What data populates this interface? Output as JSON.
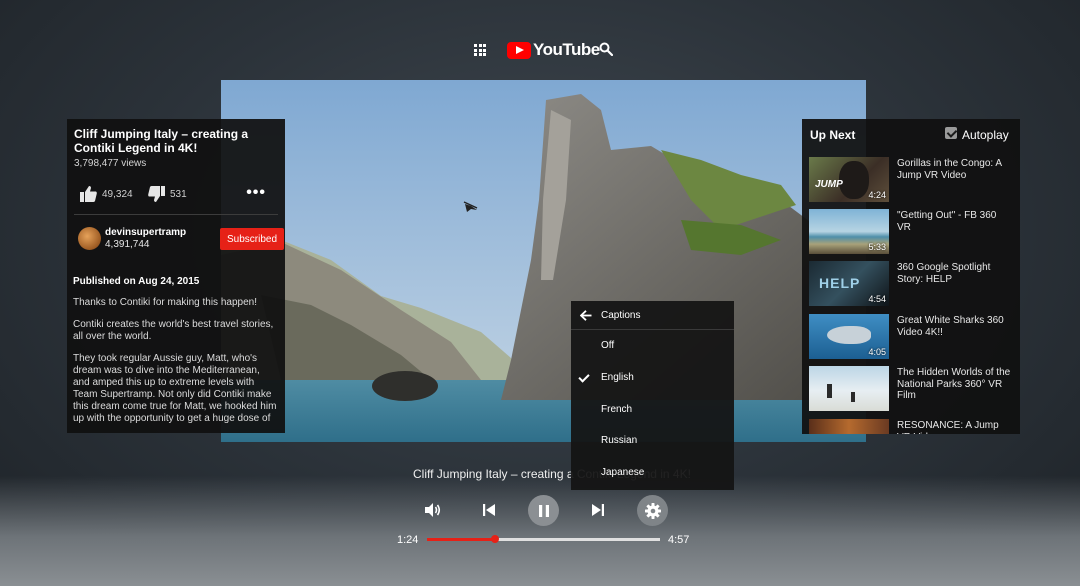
{
  "header": {
    "logo_text": "YouTube"
  },
  "video_info": {
    "title": "Cliff Jumping Italy – creating a Contiki Legend in 4K!",
    "views": "3,798,477 views",
    "likes": "49,324",
    "dislikes": "531",
    "channel_name": "devinsupertramp",
    "channel_subs": "4,391,744",
    "subscribe_label": "Subscribed",
    "published": "Published on Aug 24, 2015",
    "description": [
      "Thanks to Contiki for making this happen!",
      "Contiki creates the world's best travel stories, all over the world.",
      "They took regular Aussie guy, Matt, who's dream was to dive into the Mediterranean, and amped this up to extreme levels with Team Supertramp. Not only did Contiki make this dream come true for Matt, we hooked him up with the opportunity to get a huge dose of"
    ]
  },
  "up_next": {
    "title": "Up Next",
    "autoplay_label": "Autoplay",
    "autoplay_checked": true,
    "items": [
      {
        "title": "Gorillas in the Congo: A Jump VR Video",
        "duration": "4:24"
      },
      {
        "title": "\"Getting Out\" - FB 360 VR",
        "duration": "5:33"
      },
      {
        "title": "360 Google Spotlight Story: HELP",
        "duration": "4:54"
      },
      {
        "title": "Great White Sharks 360 Video 4K!!",
        "duration": "4:05"
      },
      {
        "title": "The Hidden Worlds of the National Parks 360° VR Film",
        "duration": ""
      },
      {
        "title": "RESONANCE: A Jump VR Video",
        "duration": ""
      }
    ]
  },
  "captions_menu": {
    "title": "Captions",
    "options": [
      "Off",
      "English",
      "French",
      "Russian",
      "Japanese"
    ],
    "selected": "English"
  },
  "player": {
    "title": "Cliff Jumping Italy – creating a Contiki Legend in 4K!",
    "current_time": "1:24",
    "total_time": "4:57",
    "progress": 0.29
  },
  "colors": {
    "accent": "#e62117",
    "panel": "#101010"
  }
}
